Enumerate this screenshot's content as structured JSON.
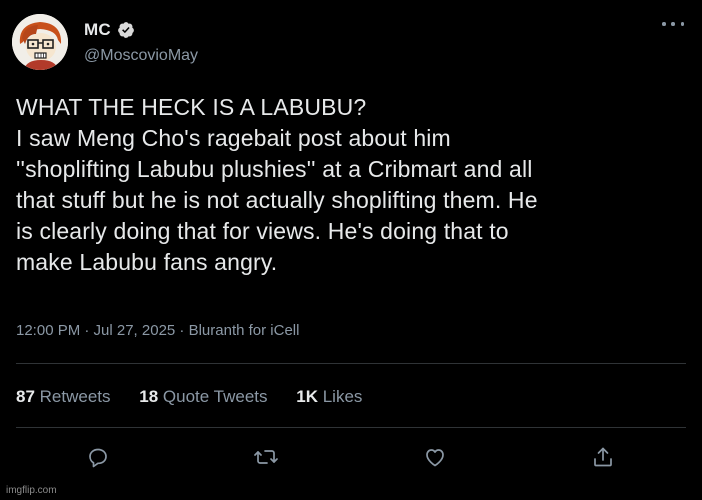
{
  "user": {
    "display_name": "MC",
    "handle": "@MoscovioMay",
    "verified_icon": "verified-badge-icon"
  },
  "tweet": {
    "lines": [
      "WHAT THE HECK IS A LABUBU?",
      "I saw Meng Cho's ragebait post about him",
      "''shoplifting Labubu plushies'' at a Cribmart and all",
      "that stuff but he is not actually shoplifting them. He",
      "is clearly doing that for views. He's doing that to",
      "make Labubu fans angry."
    ],
    "meta": "12:00 PM · Jul 27, 2025 · Bluranth for iCell"
  },
  "stats": {
    "retweets_count": "87",
    "retweets_label": "Retweets",
    "quotes_count": "18",
    "quotes_label": "Quote Tweets",
    "likes_count": "1K",
    "likes_label": "Likes"
  },
  "actions": [
    "reply-icon",
    "retweet-icon",
    "like-icon",
    "share-icon"
  ],
  "watermark": "imgflip.com",
  "colors": {
    "background": "#000000",
    "text": "#e7e9ea",
    "secondary": "#8b98a5",
    "divider": "#2f3336"
  }
}
